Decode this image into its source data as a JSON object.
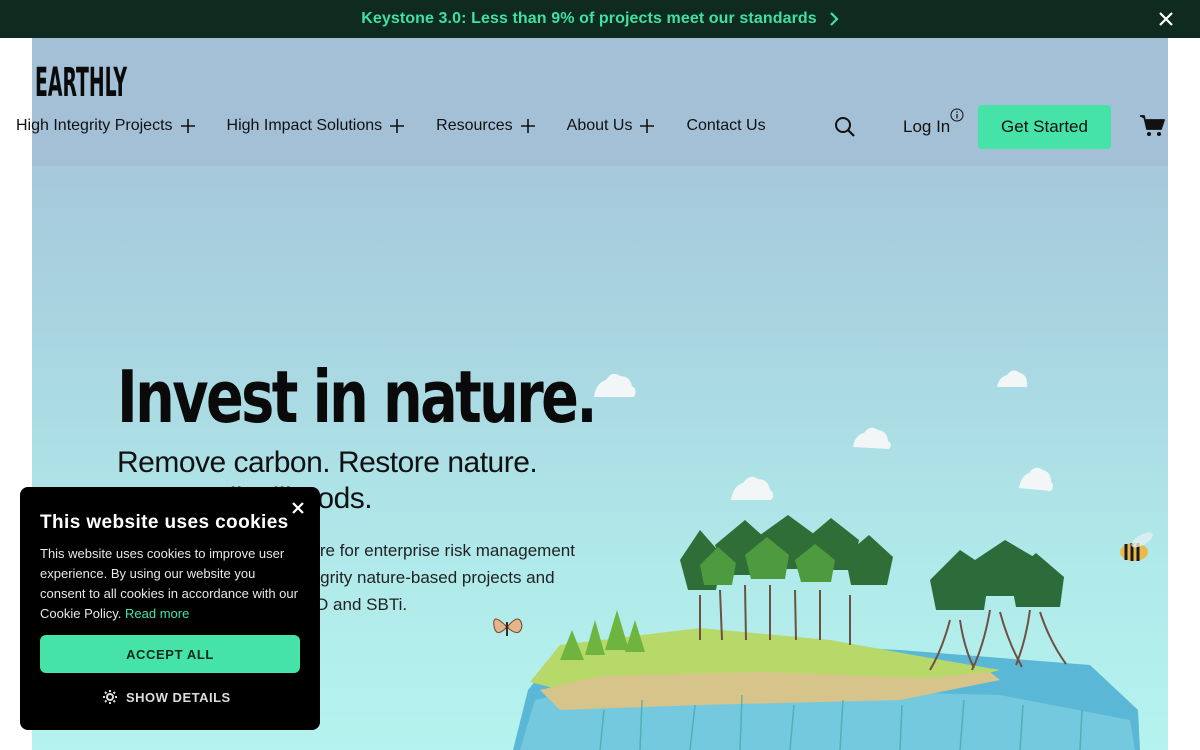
{
  "announcement": {
    "text": "Keystone 3.0: Less than 9% of projects meet our standards",
    "chevron_icon": "chevron-right-icon",
    "close_icon": "close-icon"
  },
  "header": {
    "logo_text": "EARTHLY",
    "nav": [
      {
        "label": "High Integrity Projects",
        "icon": "plus-icon"
      },
      {
        "label": "High Impact Solutions",
        "icon": "plus-icon"
      },
      {
        "label": "Resources",
        "icon": "plus-icon"
      },
      {
        "label": "About Us",
        "icon": "plus-icon"
      },
      {
        "label": "Contact Us"
      }
    ],
    "search_icon": "search-icon",
    "login_label": "Log In",
    "info_icon": "info-icon",
    "cta_label": "Get Started",
    "cart_icon": "cart-icon"
  },
  "hero": {
    "title": "Invest in nature.",
    "subtitle_line1": "Remove carbon. Restore nature.",
    "subtitle_line2": "Improve livelihoods.",
    "description": "We provide the infrastructure for enterprise risk management and investment in high-integrity nature-based projects and solutions aligned with TNFD and SBTi."
  },
  "cookie_banner": {
    "title": "This website uses cookies",
    "body": "This website uses cookies to improve user experience. By using our website you consent to all cookies in accordance with our Cookie Policy.",
    "read_more": "Read more",
    "accept_label": "ACCEPT ALL",
    "details_label": "SHOW DETAILS",
    "close_icon": "close-icon",
    "gear_icon": "gear-icon"
  },
  "colors": {
    "announcement_bg": "#0f2a1e",
    "accent": "#45e3a8",
    "sky_top": "#a3bed6",
    "sky_bottom": "#b5f3ef"
  }
}
